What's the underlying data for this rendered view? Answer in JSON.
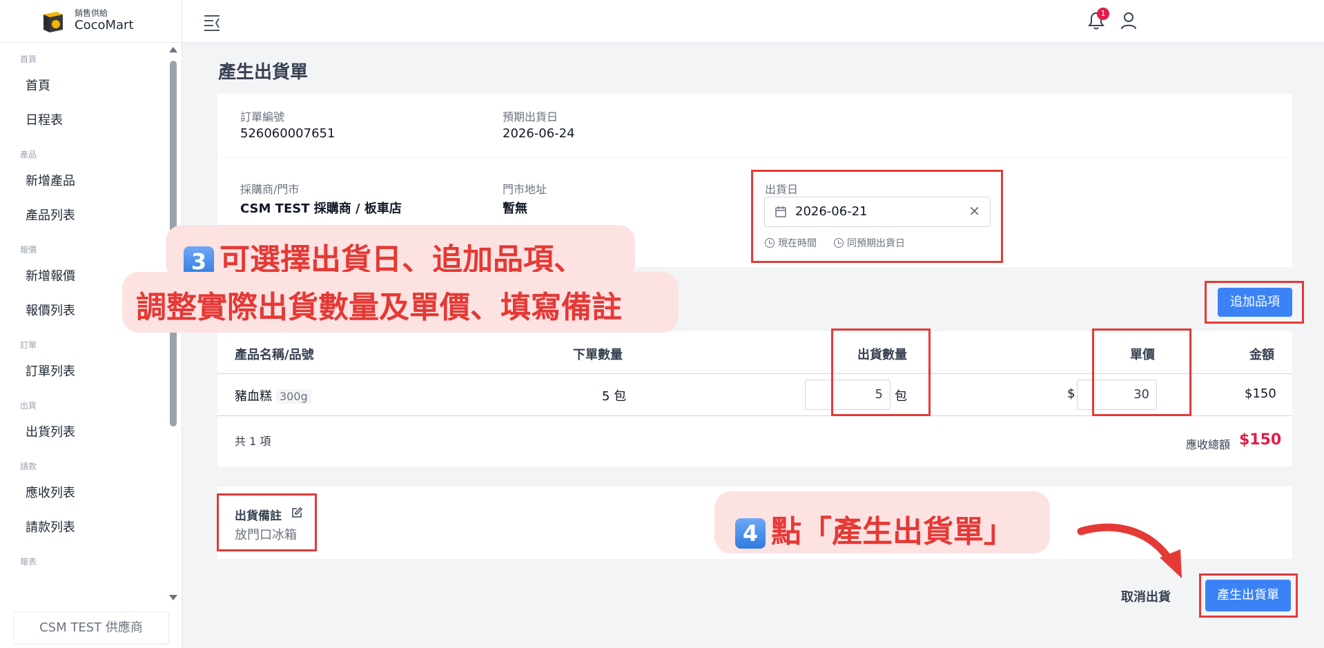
{
  "brand": {
    "subtitle": "銷售供給",
    "name": "CocoMart"
  },
  "sidebar": {
    "groups": [
      {
        "title": "首頁",
        "items": [
          "首頁",
          "日程表"
        ]
      },
      {
        "title": "產品",
        "items": [
          "新增產品",
          "產品列表"
        ]
      },
      {
        "title": "報價",
        "items": [
          "新增報價",
          "報價列表"
        ]
      },
      {
        "title": "訂單",
        "items": [
          "訂單列表"
        ]
      },
      {
        "title": "出貨",
        "items": [
          "出貨列表"
        ]
      },
      {
        "title": "請款",
        "items": [
          "應收列表",
          "請款列表"
        ]
      },
      {
        "title": "報表",
        "items": []
      }
    ],
    "supplier": "CSM TEST 供應商"
  },
  "topbar": {
    "notification_count": "1"
  },
  "page": {
    "title": "產生出貨單"
  },
  "order": {
    "order_no_label": "訂單編號",
    "order_no": "526060007651",
    "expected_date_label": "預期出貨日",
    "expected_date": "2026-06-24",
    "buyer_label": "採購商/門市",
    "buyer": "CSM TEST 採購商 / 板車店",
    "address_label": "門市地址",
    "address": "暫無",
    "ship_date_label": "出貨日",
    "ship_date": "2026-06-21",
    "now_label": "現在時間",
    "same_expected_label": "同預期出貨日"
  },
  "add_item_button": "追加品項",
  "table": {
    "headers": [
      "產品名稱/品號",
      "下單數量",
      "出貨數量",
      "單價",
      "金額"
    ],
    "rows": [
      {
        "name": "豬血糕",
        "spec": "300g",
        "order_qty": "5 包",
        "ship_qty": "5",
        "unit": "包",
        "currency": "$",
        "price": "30",
        "amount": "$150"
      }
    ],
    "count_text": "共 1 項",
    "total_label": "應收總額",
    "total": "$150"
  },
  "notes": {
    "label": "出貨備註",
    "value": "放門口冰箱"
  },
  "actions": {
    "cancel": "取消出貨",
    "submit": "產生出貨單"
  },
  "callouts": {
    "step3_num": "3",
    "step3_line1": "可選擇出貨日、追加品項、",
    "step3_line2": "調整實際出貨數量及單價、填寫備註",
    "step4_num": "4",
    "step4_text": "點「產生出貨單」"
  },
  "colors": {
    "primary": "#3b82f6",
    "highlight": "#e53935",
    "callout_bg": "#fde2e2",
    "total": "#e11d48"
  }
}
